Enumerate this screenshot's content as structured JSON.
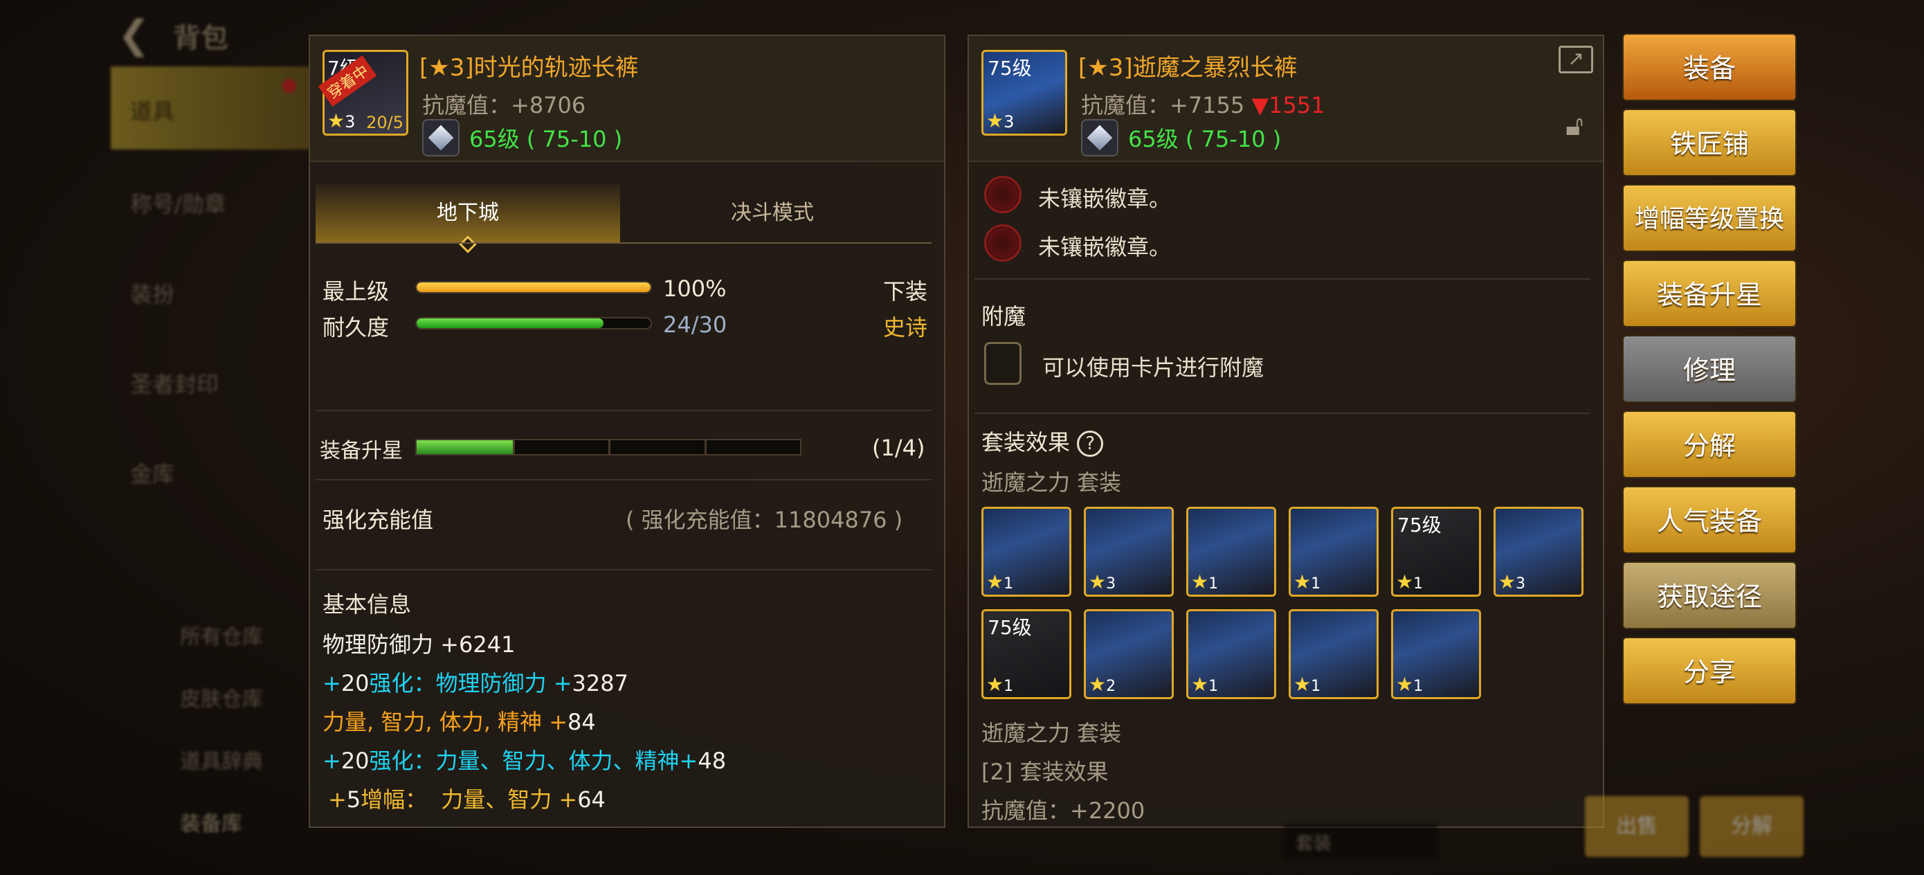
{
  "nav": {
    "title": "背包",
    "items": [
      "道具",
      "称号/勋章",
      "装扮",
      "圣者封印",
      "金库"
    ],
    "warehouse": [
      "所有仓库",
      "皮肤仓库",
      "道具辞典",
      "装备库"
    ]
  },
  "left_item": {
    "name": "[★3]时光的轨迹长裤",
    "badge": "穿着中",
    "icon_level_partial": "7",
    "icon_level_tail": "级",
    "icon_star": "3",
    "icon_progress": "20/5",
    "anti_magic": "抗魔值：+8706",
    "level_range": "65级 ( 75-10 )",
    "tabs": [
      "地下城",
      "决斗模式"
    ],
    "top_grade_label": "最上级",
    "top_grade_value": "100%",
    "top_grade_fraction": 1.0,
    "durability_label": "耐久度",
    "durability_value": "24/30",
    "durability_fraction": 0.8,
    "slot": "下装",
    "rarity": "史诗",
    "star_up_label": "装备升星",
    "star_up_value": "(1/4)",
    "star_up_fraction": 0.25,
    "enhance_label": "强化充能值",
    "enhance_value": "( 强化充能值：11804876 )",
    "basic_info_title": "基本信息",
    "basic": [
      {
        "a": "物理防御力 +",
        "b": "6241"
      },
      {
        "a": "+",
        "b": "20",
        "c": "强化：物理防御力 +",
        "d": "3287"
      },
      {
        "a": "力量, 智力, 体力, 精神 +",
        "b": "84"
      },
      {
        "a": "+",
        "b": "20",
        "c": "强化：力量、智力、体力、精神+",
        "d": "48"
      },
      {
        "a": "+",
        "b": "5",
        "c": "增幅：",
        "d": "力量、智力 +",
        "e": "64"
      }
    ]
  },
  "right_item": {
    "name": "[★3]逝魔之暴烈长裤",
    "icon_level": "75级",
    "icon_star": "3",
    "anti_magic": "抗魔值：+7155",
    "anti_magic_diff": "▼1551",
    "level_range": "65级 ( 75-10 )",
    "sockets": [
      "未镶嵌徽章。",
      "未镶嵌徽章。"
    ],
    "enchant_title": "附魔",
    "enchant_text": "可以使用卡片进行附魔",
    "set_title": "套装效果",
    "set_name": "逝魔之力  套装",
    "set_icons_row1": [
      {
        "lv": "",
        "star": "1"
      },
      {
        "lv": "",
        "star": "3"
      },
      {
        "lv": "",
        "star": "1"
      },
      {
        "lv": "",
        "star": "1"
      },
      {
        "lv": "75级",
        "star": "1"
      },
      {
        "lv": "",
        "star": "3"
      }
    ],
    "set_icons_row2": [
      {
        "lv": "75级",
        "star": "1"
      },
      {
        "lv": "",
        "star": "2"
      },
      {
        "lv": "",
        "star": "1"
      },
      {
        "lv": "",
        "star": "1"
      },
      {
        "lv": "",
        "star": "1"
      }
    ],
    "set_name_2": "逝魔之力  套装",
    "set_effect_2": "[2] 套装效果",
    "set_effect_anti": "抗魔值：+2200"
  },
  "buttons": [
    "装备",
    "铁匠铺",
    "增幅等级置换",
    "装备升星",
    "修理",
    "分解",
    "人气装备",
    "获取途径",
    "分享"
  ],
  "bottom": {
    "sell": "出售",
    "decompose": "分解",
    "dropdown": "套装"
  },
  "colors": {
    "accent_gold": "#f0a72a",
    "green": "#43e447",
    "cyan": "#1fd3f2",
    "red": "#e82424"
  }
}
